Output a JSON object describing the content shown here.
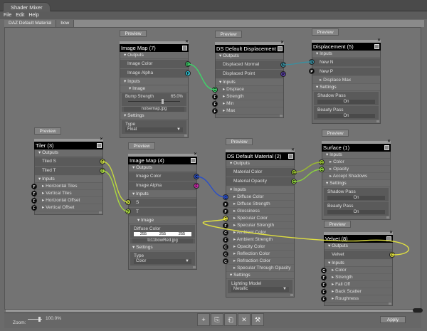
{
  "window": {
    "title": "Shader Mixer"
  },
  "menu": [
    "File",
    "Edit",
    "Help"
  ],
  "doc_tabs": [
    {
      "label": "DAZ Default Material",
      "active": false
    },
    {
      "label": "bow",
      "active": true
    }
  ],
  "nodes": [
    {
      "id": "im7",
      "title": "Image Map (7)",
      "preview": "Preview",
      "rows": [
        {
          "t": "sec",
          "label": "Outputs"
        },
        {
          "t": "out",
          "label": "Image Color",
          "port": {
            "l": "C",
            "c": "#3fd26a"
          }
        },
        {
          "t": "out",
          "label": "Image Alpha",
          "port": {
            "l": "F",
            "c": "#2fc4d6"
          }
        },
        {
          "t": "sec",
          "label": "Inputs"
        },
        {
          "t": "sec",
          "label": "Image",
          "sub": true
        },
        {
          "t": "slider",
          "label": "Bump Strength",
          "value": "65.0%",
          "level": 0.65
        },
        {
          "t": "file",
          "label": "noisemap.jpg"
        },
        {
          "t": "sec",
          "label": "Settings"
        },
        {
          "t": "select",
          "label": "Type",
          "value": "Float"
        }
      ]
    },
    {
      "id": "dd6",
      "title": "DS Default Displacement (6)",
      "preview": "Preview",
      "rows": [
        {
          "t": "sec",
          "label": "Outputs"
        },
        {
          "t": "out",
          "label": "Displaced Normal",
          "port": {
            "l": "N",
            "c": "#3a8fa0"
          }
        },
        {
          "t": "out",
          "label": "Displaced Point",
          "port": {
            "l": "P",
            "c": "#5b3fa8"
          }
        },
        {
          "t": "sec",
          "label": "Inputs"
        },
        {
          "t": "in",
          "label": "Displace",
          "port": {
            "l": "C",
            "c": "#3fd26a"
          }
        },
        {
          "t": "in",
          "label": "Strength",
          "port": {
            "l": "F",
            "c": "#000"
          }
        },
        {
          "t": "in",
          "label": "Min",
          "port": {
            "l": "F",
            "c": "#000"
          }
        },
        {
          "t": "in",
          "label": "Max",
          "port": {
            "l": "F",
            "c": "#000"
          }
        }
      ]
    },
    {
      "id": "d5",
      "title": "Displacement (5)",
      "preview": "Preview",
      "rows": [
        {
          "t": "sec",
          "label": "Inputs"
        },
        {
          "t": "inbox",
          "label": "New N",
          "port": {
            "l": "N",
            "c": "#3a8fa0"
          }
        },
        {
          "t": "inbox",
          "label": "New P",
          "port": {
            "l": "P",
            "c": "#000"
          }
        },
        {
          "t": "in",
          "label": "Displace Max"
        },
        {
          "t": "sec",
          "label": "Settings"
        },
        {
          "t": "button",
          "label": "Shadow Pass",
          "value": "On"
        },
        {
          "t": "button",
          "label": "Beauty Pass",
          "value": "On"
        }
      ]
    },
    {
      "id": "t3",
      "title": "Tiler (3)",
      "preview": "Preview",
      "rows": [
        {
          "t": "sec",
          "label": "Outputs"
        },
        {
          "t": "out",
          "label": "Tiled S",
          "port": {
            "l": "F",
            "c": "#c4d640"
          }
        },
        {
          "t": "out",
          "label": "Tiled T",
          "port": {
            "l": "F",
            "c": "#a8d640"
          }
        },
        {
          "t": "sec",
          "label": "Inputs"
        },
        {
          "t": "in",
          "label": "Horizontal Tiles",
          "port": {
            "l": "F",
            "c": "#000"
          }
        },
        {
          "t": "in",
          "label": "Vertical Tiles",
          "port": {
            "l": "F",
            "c": "#000"
          }
        },
        {
          "t": "in",
          "label": "Horizontal Offset",
          "port": {
            "l": "F",
            "c": "#000"
          }
        },
        {
          "t": "in",
          "label": "Vertical Offset",
          "port": {
            "l": "F",
            "c": "#000"
          }
        }
      ]
    },
    {
      "id": "im4",
      "title": "Image Map (4)",
      "preview": "Preview",
      "rows": [
        {
          "t": "sec",
          "label": "Outputs"
        },
        {
          "t": "out",
          "label": "Image Color",
          "port": {
            "l": "C",
            "c": "#2a4fc8"
          }
        },
        {
          "t": "out",
          "label": "Image Alpha",
          "port": {
            "l": "F",
            "c": "#d02ab0"
          }
        },
        {
          "t": "sec",
          "label": "Inputs"
        },
        {
          "t": "inbox",
          "label": "S",
          "port": {
            "l": "F",
            "c": "#c4d640"
          }
        },
        {
          "t": "inbox",
          "label": "T",
          "port": {
            "l": "F",
            "c": "#a8d640"
          }
        },
        {
          "t": "sec",
          "label": "Image",
          "sub": true
        },
        {
          "t": "color",
          "label": "Diffuse Color",
          "values": [
            "255",
            "255",
            "255"
          ]
        },
        {
          "t": "file",
          "label": "tc11bowRed.jpg"
        },
        {
          "t": "sec",
          "label": "Settings"
        },
        {
          "t": "select",
          "label": "Type",
          "value": "Color"
        }
      ]
    },
    {
      "id": "m2",
      "title": "DS Default Material (2)",
      "preview": "Preview",
      "rows": [
        {
          "t": "sec",
          "label": "Outputs"
        },
        {
          "t": "out",
          "label": "Material Color",
          "port": {
            "l": "C",
            "c": "#9ac832"
          }
        },
        {
          "t": "out",
          "label": "Material Opacity",
          "port": {
            "l": "C",
            "c": "#9ae040"
          }
        },
        {
          "t": "sec",
          "label": "Inputs"
        },
        {
          "t": "in",
          "label": "Diffuse Color",
          "port": {
            "l": "C",
            "c": "#2a4fc8"
          }
        },
        {
          "t": "in",
          "label": "Diffuse Strength",
          "port": {
            "l": "F",
            "c": "#000"
          }
        },
        {
          "t": "in",
          "label": "Glossiness",
          "port": {
            "l": "F",
            "c": "#000"
          }
        },
        {
          "t": "in",
          "label": "Specular Color",
          "port": {
            "l": "C",
            "c": "#e0e040"
          }
        },
        {
          "t": "in",
          "label": "Specular Strength",
          "port": {
            "l": "F",
            "c": "#000"
          }
        },
        {
          "t": "in",
          "label": "Ambient Color",
          "port": {
            "l": "C",
            "c": "#000"
          }
        },
        {
          "t": "in",
          "label": "Ambient Strength",
          "port": {
            "l": "F",
            "c": "#000"
          }
        },
        {
          "t": "in",
          "label": "Opacity Color",
          "port": {
            "l": "C",
            "c": "#000"
          }
        },
        {
          "t": "in",
          "label": "Reflection Color",
          "port": {
            "l": "C",
            "c": "#000"
          }
        },
        {
          "t": "in",
          "label": "Refraction Color",
          "port": {
            "l": "C",
            "c": "#000"
          }
        },
        {
          "t": "in",
          "label": "Specular Through Opacity"
        },
        {
          "t": "sec",
          "label": "Settings"
        },
        {
          "t": "select",
          "label": "Lighting Model",
          "value": "Metallic"
        }
      ]
    },
    {
      "id": "s1",
      "title": "Surface (1)",
      "preview": "Preview",
      "rows": [
        {
          "t": "sec",
          "label": "Inputs"
        },
        {
          "t": "in",
          "label": "Color",
          "port": {
            "l": "C",
            "c": "#9ac832"
          }
        },
        {
          "t": "in",
          "label": "Opacity",
          "port": {
            "l": "C",
            "c": "#9ae040"
          }
        },
        {
          "t": "in",
          "label": "Accept Shadows"
        },
        {
          "t": "sec",
          "label": "Settings"
        },
        {
          "t": "button",
          "label": "Shadow Pass",
          "value": "On"
        },
        {
          "t": "button",
          "label": "Beauty Pass",
          "value": "On"
        }
      ]
    },
    {
      "id": "v8",
      "title": "Velvet (8)",
      "preview": "Preview",
      "rows": [
        {
          "t": "sec",
          "label": "Outputs"
        },
        {
          "t": "out",
          "label": "Velvet",
          "port": {
            "l": "C",
            "c": "#e0e040"
          }
        },
        {
          "t": "sec",
          "label": "Inputs"
        },
        {
          "t": "in",
          "label": "Color",
          "port": {
            "l": "C",
            "c": "#000"
          }
        },
        {
          "t": "in",
          "label": "Strength",
          "port": {
            "l": "F",
            "c": "#000"
          }
        },
        {
          "t": "in",
          "label": "Fall Off",
          "port": {
            "l": "F",
            "c": "#000"
          }
        },
        {
          "t": "in",
          "label": "Back Scatter",
          "port": {
            "l": "F",
            "c": "#000"
          }
        },
        {
          "t": "in",
          "label": "Roughness",
          "port": {
            "l": "F",
            "c": "#000"
          }
        }
      ]
    }
  ],
  "connections": [
    {
      "from": [
        "im7",
        "Image Color"
      ],
      "to": [
        "dd6",
        "Displace"
      ],
      "color": "#3fd26a"
    },
    {
      "from": [
        "dd6",
        "Displaced Normal"
      ],
      "to": [
        "d5",
        "New N"
      ],
      "color": "#3a8fa0"
    },
    {
      "from": [
        "t3",
        "Tiled S"
      ],
      "to": [
        "im4",
        "S"
      ],
      "color": "#c4d640"
    },
    {
      "from": [
        "t3",
        "Tiled T"
      ],
      "to": [
        "im4",
        "T"
      ],
      "color": "#a8d640"
    },
    {
      "from": [
        "im4",
        "Image Color"
      ],
      "to": [
        "m2",
        "Diffuse Color"
      ],
      "color": "#2a4fc8"
    },
    {
      "from": [
        "m2",
        "Material Color"
      ],
      "to": [
        "s1",
        "Color"
      ],
      "color": "#9ab832"
    },
    {
      "from": [
        "m2",
        "Material Opacity"
      ],
      "to": [
        "s1",
        "Opacity"
      ],
      "color": "#8ad040"
    },
    {
      "from": [
        "v8",
        "Velvet"
      ],
      "to": [
        "m2",
        "Specular Color"
      ],
      "color": "#e0e040"
    }
  ],
  "footer": {
    "zoom_label": "Zoom:",
    "zoom_value": "100.0%",
    "zoom_level": 1.0,
    "apply": "Apply",
    "tools": [
      {
        "icon": "add-icon",
        "glyph": "+"
      },
      {
        "icon": "copy-icon",
        "glyph": "⎘"
      },
      {
        "icon": "paste-icon",
        "glyph": "⎗"
      },
      {
        "icon": "delete-icon",
        "glyph": "✕"
      },
      {
        "icon": "tools-icon",
        "glyph": "⚒"
      }
    ]
  }
}
